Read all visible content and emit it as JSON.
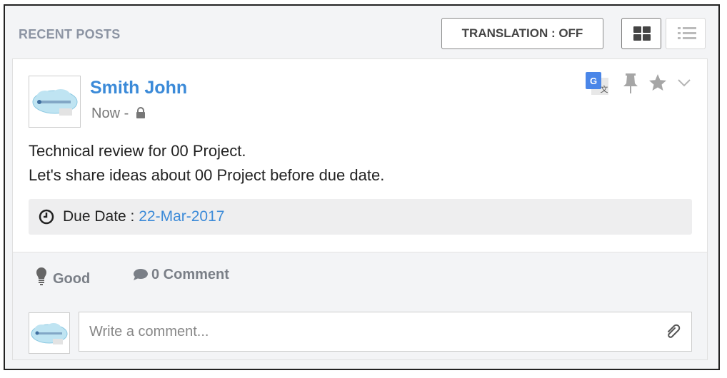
{
  "header": {
    "title": "RECENT POSTS",
    "translation_label": "TRANSLATION : OFF"
  },
  "post": {
    "author": "Smith John",
    "time": "Now -",
    "lines": [
      "Technical review for 00 Project.",
      "Let's share ideas about 00 Project before due date."
    ],
    "due_label": "Due Date :",
    "due_date": "22-Mar-2017",
    "like_label": "Good",
    "comment_label": "0 Comment"
  },
  "comment": {
    "placeholder": "Write a comment..."
  },
  "icons": {
    "view_grid": "grid-view-icon",
    "view_list": "list-view-icon",
    "lock": "lock-icon",
    "translate": "google-translate-icon",
    "pin": "pin-icon",
    "star": "star-icon",
    "chevron": "chevron-down-icon",
    "clock": "clock-icon",
    "bulb": "lightbulb-icon",
    "comment": "comment-bubble-icon",
    "attach": "paperclip-icon"
  },
  "colors": {
    "accent": "#3b8ad8",
    "background": "#f3f4f6",
    "muted_text": "#7a7f87"
  }
}
